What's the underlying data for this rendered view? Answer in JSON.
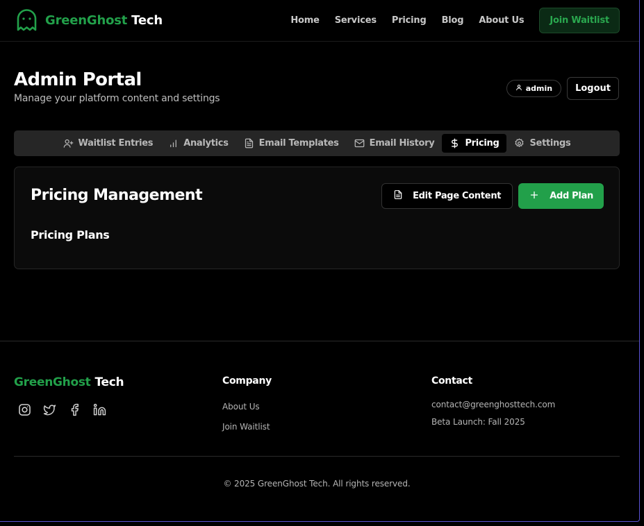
{
  "header": {
    "brand_primary": "GreenGhost",
    "brand_secondary": "Tech",
    "nav": [
      "Home",
      "Services",
      "Pricing",
      "Blog",
      "About Us"
    ],
    "cta_label": "Join Waitlist"
  },
  "admin": {
    "title": "Admin Portal",
    "subtitle": "Manage your platform content and settings",
    "user_label": "admin",
    "logout_label": "Logout"
  },
  "tabs": [
    {
      "label": "Waitlist Entries",
      "icon": "user-plus-icon"
    },
    {
      "label": "Analytics",
      "icon": "bar-chart-icon"
    },
    {
      "label": "Email Templates",
      "icon": "file-text-icon"
    },
    {
      "label": "Email History",
      "icon": "mail-icon"
    },
    {
      "label": "Pricing",
      "icon": "dollar-icon",
      "active": true
    },
    {
      "label": "Settings",
      "icon": "gear-icon"
    }
  ],
  "pricing": {
    "title": "Pricing Management",
    "edit_label": "Edit Page Content",
    "add_label": "Add Plan",
    "section_title": "Pricing Plans"
  },
  "footer": {
    "brand_primary": "GreenGhost",
    "brand_secondary": "Tech",
    "socials": [
      "instagram-icon",
      "twitter-icon",
      "facebook-icon",
      "linkedin-icon"
    ],
    "company_heading": "Company",
    "company_links": [
      "About Us",
      "Join Waitlist"
    ],
    "contact_heading": "Contact",
    "contact_email": "contact@greenghosttech.com",
    "contact_note": "Beta Launch: Fall 2025",
    "copyright": "© 2025 GreenGhost Tech. All rights reserved."
  },
  "colors": {
    "accent": "#22a04a",
    "background": "#000000",
    "panel": "#0b0b0b",
    "tabs_bg": "#262626"
  }
}
